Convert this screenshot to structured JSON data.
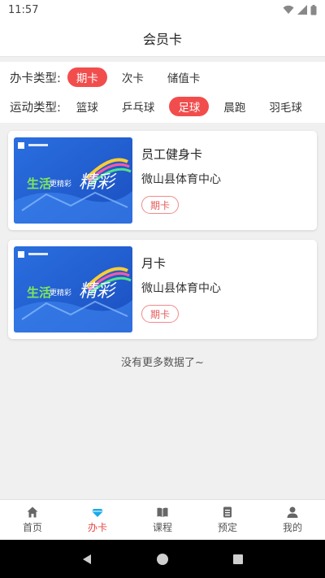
{
  "status_bar": {
    "time": "11:57"
  },
  "header": {
    "title": "会员卡"
  },
  "filters": {
    "card_type": {
      "label": "办卡类型:",
      "options": [
        "期卡",
        "次卡",
        "储值卡"
      ],
      "selected": "期卡"
    },
    "sport_type": {
      "label": "运动类型:",
      "options": [
        "篮球",
        "乒乓球",
        "足球",
        "晨跑",
        "羽毛球"
      ],
      "selected": "足球"
    }
  },
  "cards": [
    {
      "name": "员工健身卡",
      "venue": "微山县体育中心",
      "tag": "期卡",
      "thumb_text": "生活更精彩",
      "thumb_big": "精彩"
    },
    {
      "name": "月卡",
      "venue": "微山县体育中心",
      "tag": "期卡",
      "thumb_text": "生活更精彩",
      "thumb_big": "精彩"
    }
  ],
  "list_footer": "没有更多数据了~",
  "tabs": [
    {
      "label": "首页",
      "icon": "home-icon"
    },
    {
      "label": "办卡",
      "icon": "diamond-icon",
      "active": true
    },
    {
      "label": "课程",
      "icon": "book-icon"
    },
    {
      "label": "预定",
      "icon": "clipboard-icon"
    },
    {
      "label": "我的",
      "icon": "person-icon"
    }
  ],
  "colors": {
    "accent": "#f24d4d",
    "tag_border": "#f08b8b",
    "background": "#f0f0f0"
  }
}
